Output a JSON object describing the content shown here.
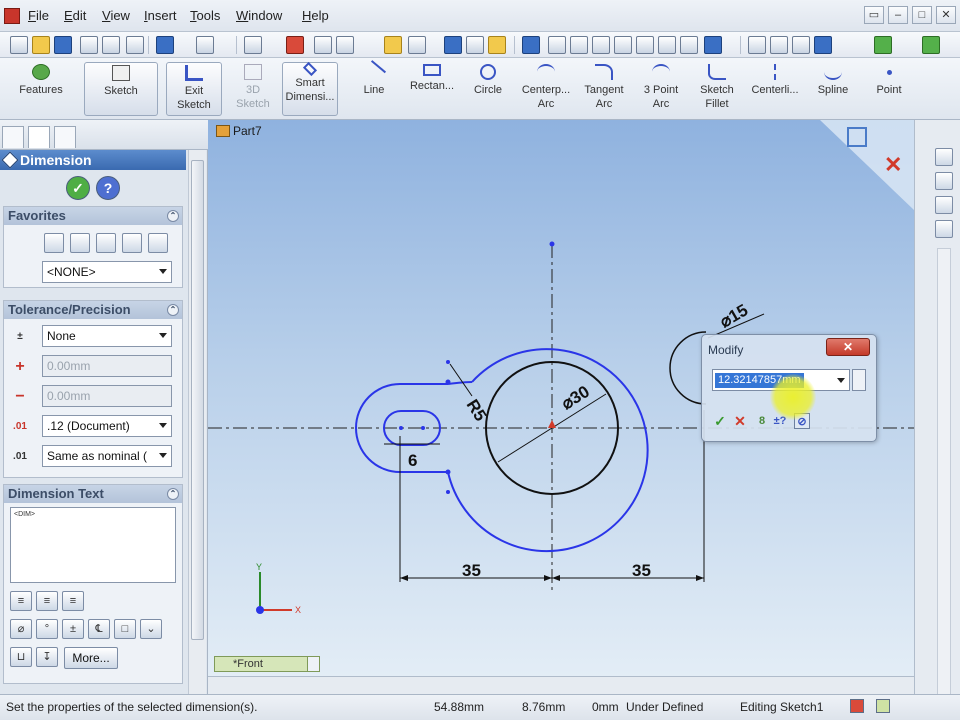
{
  "menu": {
    "items": [
      {
        "key": "F",
        "rest": "ile"
      },
      {
        "key": "E",
        "rest": "dit"
      },
      {
        "key": "V",
        "rest": "iew"
      },
      {
        "key": "I",
        "rest": "nsert"
      },
      {
        "key": "T",
        "rest": "ools"
      },
      {
        "key": "W",
        "rest": "indow"
      },
      {
        "key": "H",
        "rest": "elp"
      }
    ],
    "window_buttons": [
      "▭",
      "–",
      "□",
      "✕"
    ]
  },
  "command_manager": {
    "tools": [
      {
        "label": "Features",
        "label2": "",
        "icon": "features-icon"
      },
      {
        "label": "Sketch",
        "label2": "",
        "icon": "sketch-icon"
      },
      {
        "label": "Exit",
        "label2": "Sketch",
        "icon": "exit-sketch-icon"
      },
      {
        "label": "3D",
        "label2": "Sketch",
        "icon": "3d-sketch-icon"
      },
      {
        "label": "Smart",
        "label2": "Dimensi...",
        "icon": "smart-dimension-icon"
      },
      {
        "label": "Line",
        "label2": "",
        "icon": "line-icon"
      },
      {
        "label": "Rectan...",
        "label2": "",
        "icon": "rectangle-icon"
      },
      {
        "label": "Circle",
        "label2": "",
        "icon": "circle-icon"
      },
      {
        "label": "Centerp...",
        "label2": "Arc",
        "icon": "centerpoint-arc-icon"
      },
      {
        "label": "Tangent",
        "label2": "Arc",
        "icon": "tangent-arc-icon"
      },
      {
        "label": "3 Point",
        "label2": "Arc",
        "icon": "3point-arc-icon"
      },
      {
        "label": "Sketch",
        "label2": "Fillet",
        "icon": "sketch-fillet-icon"
      },
      {
        "label": "Centerli...",
        "label2": "",
        "icon": "centerline-icon"
      },
      {
        "label": "Spline",
        "label2": "",
        "icon": "spline-icon"
      },
      {
        "label": "Point",
        "label2": "",
        "icon": "point-icon"
      }
    ]
  },
  "property_manager": {
    "title": "Dimension",
    "favorites": {
      "title": "Favorites",
      "selection": "<NONE>"
    },
    "tolerance": {
      "title": "Tolerance/Precision",
      "type": "None",
      "plus": "0.00mm",
      "minus": "0.00mm",
      "precision": ".12 (Document)",
      "tolerance_precision": "Same as nominal ("
    },
    "dimension_text": {
      "title": "Dimension Text",
      "text": "<DIM>",
      "more_label": "More..."
    }
  },
  "graphics": {
    "part_name": "Part7",
    "view_name": "*Front",
    "dimensions": {
      "r5": "R5",
      "d30": "⌀30",
      "d15": "⌀15",
      "six": "6",
      "left35": "35",
      "right35": "35"
    },
    "axis_x": "X",
    "axis_y": "Y"
  },
  "modify_dialog": {
    "title": "Modify",
    "value": "12.32147857mm",
    "close": "✕"
  },
  "status": {
    "message": "Set the properties of the selected dimension(s).",
    "x": "54.88mm",
    "y": "8.76mm",
    "z": "0mm",
    "definition": "Under Defined",
    "mode": "Editing Sketch1"
  },
  "colors": {
    "sketch_blue": "#2a35e8",
    "sketch_black": "#111111",
    "accent_red": "#c8352b"
  }
}
